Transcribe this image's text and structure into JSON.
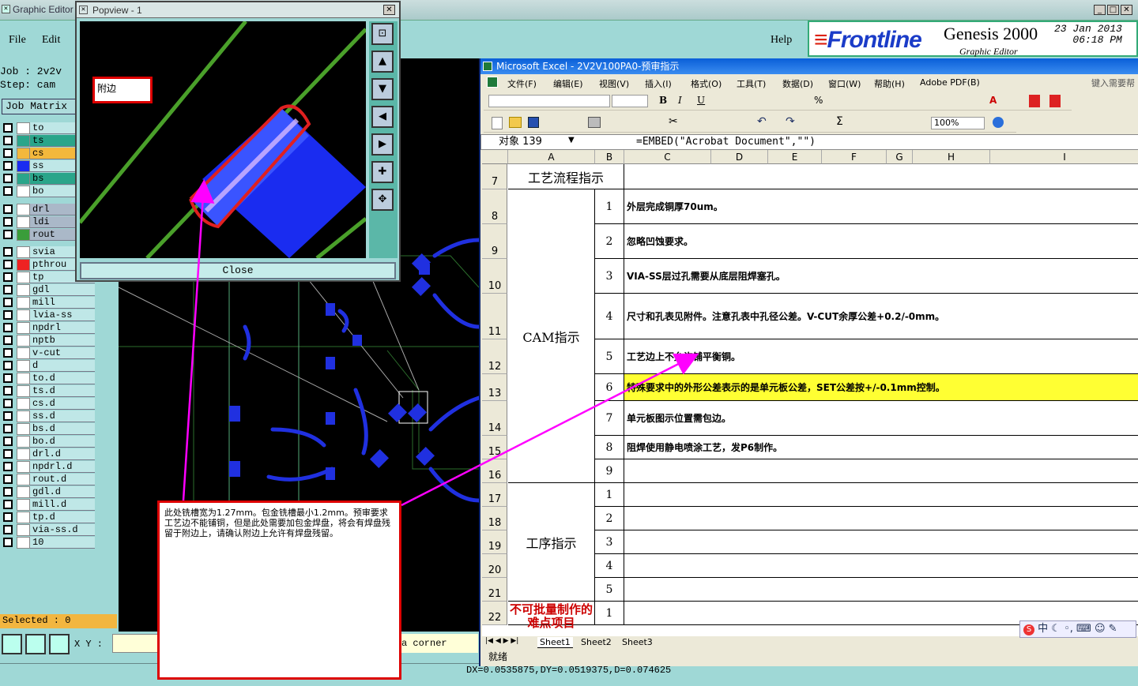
{
  "graphic_editor": {
    "title": "Graphic Editor",
    "menu": {
      "file": "File",
      "edit": "Edit",
      "help": "Help"
    },
    "job_label": "Job : 2v2v",
    "step_label": "Step: cam",
    "job_matrix": "Job Matrix",
    "layers": [
      {
        "name": "to",
        "color": "#ffffff"
      },
      {
        "name": "ts",
        "color": "#2aa58a"
      },
      {
        "name": "cs",
        "color": "#f3b83c"
      },
      {
        "name": "ss",
        "color": "#1a2cf0"
      },
      {
        "name": "bs",
        "color": "#2aa58a"
      },
      {
        "name": "bo",
        "color": "#ffffff"
      },
      {
        "name": "drl",
        "color": "#ffffff"
      },
      {
        "name": "ldi",
        "color": "#ffffff"
      },
      {
        "name": "rout",
        "color": "#3a9d3a"
      },
      {
        "name": "svia",
        "color": "#ffffff"
      },
      {
        "name": "pthrou",
        "color": "#ee2222"
      },
      {
        "name": "tp",
        "color": "#ffffff"
      },
      {
        "name": "gdl",
        "color": "#ffffff"
      },
      {
        "name": "mill",
        "color": "#ffffff"
      },
      {
        "name": "lvia-ss",
        "color": "#ffffff"
      },
      {
        "name": "npdrl",
        "color": "#ffffff"
      },
      {
        "name": "nptb",
        "color": "#ffffff"
      },
      {
        "name": "v-cut",
        "color": "#ffffff"
      },
      {
        "name": "d",
        "color": "#ffffff"
      },
      {
        "name": "to.d",
        "color": "#ffffff"
      },
      {
        "name": "ts.d",
        "color": "#ffffff"
      },
      {
        "name": "cs.d",
        "color": "#ffffff"
      },
      {
        "name": "ss.d",
        "color": "#ffffff"
      },
      {
        "name": "bs.d",
        "color": "#ffffff"
      },
      {
        "name": "bo.d",
        "color": "#ffffff"
      },
      {
        "name": "drl.d",
        "color": "#ffffff"
      },
      {
        "name": "npdrl.d",
        "color": "#ffffff"
      },
      {
        "name": "rout.d",
        "color": "#ffffff"
      },
      {
        "name": "gdl.d",
        "color": "#ffffff"
      },
      {
        "name": "mill.d",
        "color": "#ffffff"
      },
      {
        "name": "tp.d",
        "color": "#ffffff"
      },
      {
        "name": "via-ss.d",
        "color": "#ffffff"
      },
      {
        "name": "10",
        "color": "#ffffff"
      }
    ],
    "selected": "Selected : 0",
    "xy_label": "X Y :",
    "corner_text": "a corner",
    "coords": "DX=0.0535875,DY=0.0519375,D=0.074625"
  },
  "frontline": {
    "logo": "Frontline",
    "product": "Genesis 2000",
    "subtitle": "Graphic Editor",
    "date": "23 Jan 2013",
    "time": "06:18 PM"
  },
  "popview": {
    "title": "Popview - 1",
    "close": "Close",
    "label": "附边"
  },
  "excel": {
    "title": "Microsoft Excel - 2V2V100PA0-预审指示",
    "menu": [
      "文件(F)",
      "编辑(E)",
      "视图(V)",
      "插入(I)",
      "格式(O)",
      "工具(T)",
      "数据(D)",
      "窗口(W)",
      "帮助(H)",
      "Adobe PDF(B)"
    ],
    "help_prompt": "键入需要帮",
    "zoom": "100%",
    "name_box": "对象 139",
    "formula": "=EMBED(\"Acrobat Document\",\"\")",
    "columns": [
      "A",
      "B",
      "C",
      "D",
      "E",
      "F",
      "G",
      "H",
      "I"
    ],
    "row_numbers": [
      "7",
      "8",
      "9",
      "10",
      "11",
      "12",
      "13",
      "14",
      "15",
      "16",
      "17",
      "18",
      "19",
      "20",
      "21",
      "22"
    ],
    "section_process": "工艺流程指示",
    "section_cam": "CAM指示",
    "section_steps": "工序指示",
    "section_difficult": "不可批量制作的难点项目",
    "cam_items": [
      {
        "num": "1",
        "text": "外层完成铜厚70um。"
      },
      {
        "num": "2",
        "text": "忽略凹蚀要求。"
      },
      {
        "num": "3",
        "text": "VIA-SS层过孔需要从底层阻焊塞孔。"
      },
      {
        "num": "4",
        "text": "尺寸和孔表见附件。注意孔表中孔径公差。V-CUT余厚公差+0.2/-0mm。"
      },
      {
        "num": "5",
        "text": "工艺边上不允许铺平衡铜。"
      },
      {
        "num": "6",
        "text": "特殊要求中的外形公差表示的是单元板公差，SET公差按+/-0.1mm控制。"
      },
      {
        "num": "7",
        "text": "单元板图示位置需包边。"
      },
      {
        "num": "8",
        "text": "阻焊使用静电喷涂工艺，发P6制作。"
      },
      {
        "num": "9",
        "text": ""
      }
    ],
    "step_items": [
      "1",
      "2",
      "3",
      "4",
      "5"
    ],
    "difficult_items": [
      "1"
    ],
    "highlight_color": "#ffff33",
    "sheet_tabs": [
      "Sheet1",
      "Sheet2",
      "Sheet3"
    ],
    "status": "就绪"
  },
  "ime": "中",
  "annotation": "此处铣槽宽为1.27mm。包金铣槽最小1.2mm。预审要求工艺边不能铺铜，但是此处需要加包金焊盘，将会有焊盘残留于附边上，请确认附边上允许有焊盘残留。"
}
